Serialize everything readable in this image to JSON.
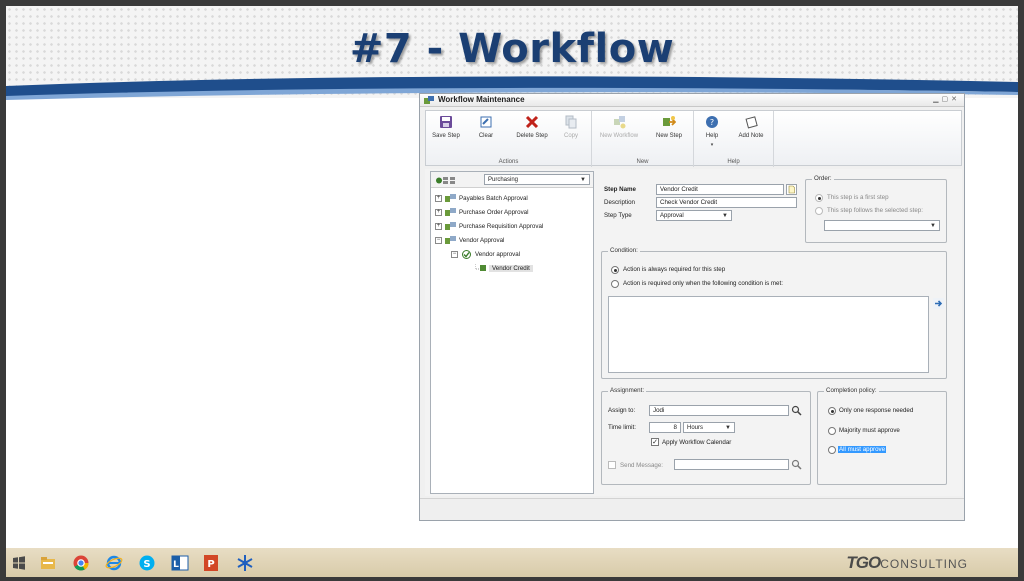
{
  "slide": {
    "title": "#7 - Workflow"
  },
  "window": {
    "title": "Workflow Maintenance"
  },
  "ribbon": {
    "groups": [
      {
        "label": "Actions",
        "buttons": [
          "Save Step",
          "Clear",
          "Delete Step",
          "Copy"
        ]
      },
      {
        "label": "New",
        "buttons": [
          "New Workflow",
          "New Step"
        ]
      },
      {
        "label": "Help",
        "buttons": [
          "Help",
          "Add Note"
        ]
      }
    ],
    "help_arrow": "▾"
  },
  "tree": {
    "dropdown_value": "Purchasing",
    "items": [
      {
        "label": "Payables Batch Approval",
        "expander": "+"
      },
      {
        "label": "Purchase Order Approval",
        "expander": "+"
      },
      {
        "label": "Purchase Requisition Approval",
        "expander": "+"
      },
      {
        "label": "Vendor Approval",
        "expander": "−"
      },
      {
        "label": "Vendor approval",
        "expander": "−"
      },
      {
        "label": "Vendor Credit",
        "expander": ""
      }
    ]
  },
  "step": {
    "name_label": "Step Name",
    "name_value": "Vendor Credit",
    "description_label": "Description",
    "description_value": "Check Vendor Credit",
    "type_label": "Step Type",
    "type_value": "Approval"
  },
  "order": {
    "legend": "Order:",
    "option_first": "This step is a first step",
    "option_follows": "This step follows the selected step:"
  },
  "condition": {
    "legend": "Condition:",
    "option_always": "Action is always required for this step",
    "option_conditional": "Action is required only when the following condition is met:"
  },
  "assignment": {
    "legend": "Assignment:",
    "assign_label": "Assign to:",
    "assign_value": "Jodi",
    "time_label": "Time limit:",
    "time_value": "8",
    "time_unit": "Hours",
    "calendar_label": "Apply Workflow Calendar",
    "send_message_label": "Send Message:"
  },
  "completion": {
    "legend": "Completion policy:",
    "option_one": "Only one response needed",
    "option_majority": "Majority must approve",
    "option_all": "All must approve"
  },
  "branding": {
    "logo_bold": "TGO",
    "logo_rest": "CONSULTING"
  },
  "colors": {
    "title": "#1b3f73",
    "swoosh": "#1f4e8c",
    "selection": "#3399ff"
  }
}
